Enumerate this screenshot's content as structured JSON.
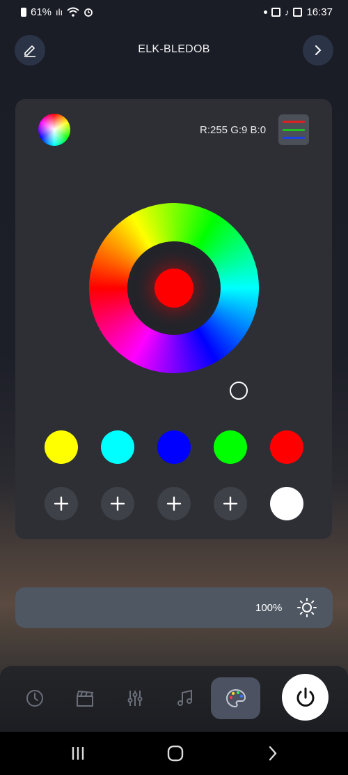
{
  "status_bar": {
    "battery": "61%",
    "time": "16:37"
  },
  "header": {
    "title": "ELK-BLEDOB"
  },
  "panel": {
    "rgb_readout": "R:255 G:9 B:0",
    "current_color": "#ff0000",
    "mode_lines": [
      "#e02020",
      "#20c020",
      "#2040e0"
    ],
    "presets": [
      "#ffff00",
      "#00ffff",
      "#0000ff",
      "#00ff00",
      "#ff0000"
    ],
    "custom_slots": [
      "add",
      "add",
      "add",
      "add",
      "#ffffff"
    ]
  },
  "brightness": {
    "value": "100%"
  },
  "bottom_nav": {
    "items": [
      "clock-icon",
      "clapperboard-icon",
      "sliders-icon",
      "music-icon",
      "palette-icon"
    ],
    "active": "palette-icon"
  },
  "colors": {
    "panel_bg": "#2d2f35",
    "brightness_bg": "#4f5763",
    "accent_button": "#2b3446"
  }
}
